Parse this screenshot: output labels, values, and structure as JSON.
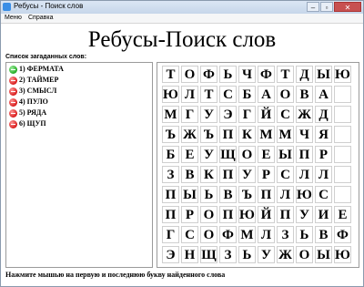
{
  "window": {
    "title": "Ребусы - Поиск слов",
    "icon": "puzzle-app-icon"
  },
  "controls": {
    "minimize": "–",
    "maximize": "▫",
    "close": "✕"
  },
  "menu": {
    "items": [
      "Меню",
      "Справка"
    ]
  },
  "heading": "Ребусы-Поиск слов",
  "word_list": {
    "caption": "Список загаданных слов:",
    "words": [
      {
        "label": "1) ФЕРМАТА",
        "status": "found"
      },
      {
        "label": "2) ТАЙМЕР",
        "status": "pending"
      },
      {
        "label": "3) СМЫСЛ",
        "status": "pending"
      },
      {
        "label": "4) ПУЛО",
        "status": "pending"
      },
      {
        "label": "5) РЯДА",
        "status": "pending"
      },
      {
        "label": "6) ЩУП",
        "status": "pending"
      }
    ]
  },
  "status_colors": {
    "found": "#22aa22",
    "pending": "#d81818"
  },
  "grid": {
    "rows": [
      "ТОФЬЧФТДЫЮ",
      "ЮЛТСБАОВА ",
      "МГУЭГЙСЖД ",
      "ЪЖЪПКММЧЯ ",
      "БЕУЩОЕЫПР ",
      "ЗВКПУРСЛЛ ",
      "ПЫЬВЪПЛЮС ",
      "ПРОПЮЙПУИЕ",
      "ГСОФМЛЗЬВФ",
      "ЭНЩЗЬУЖОЫЮ"
    ]
  },
  "status_text": "Нажмите мышью на первую и последнюю букву найденного слова"
}
